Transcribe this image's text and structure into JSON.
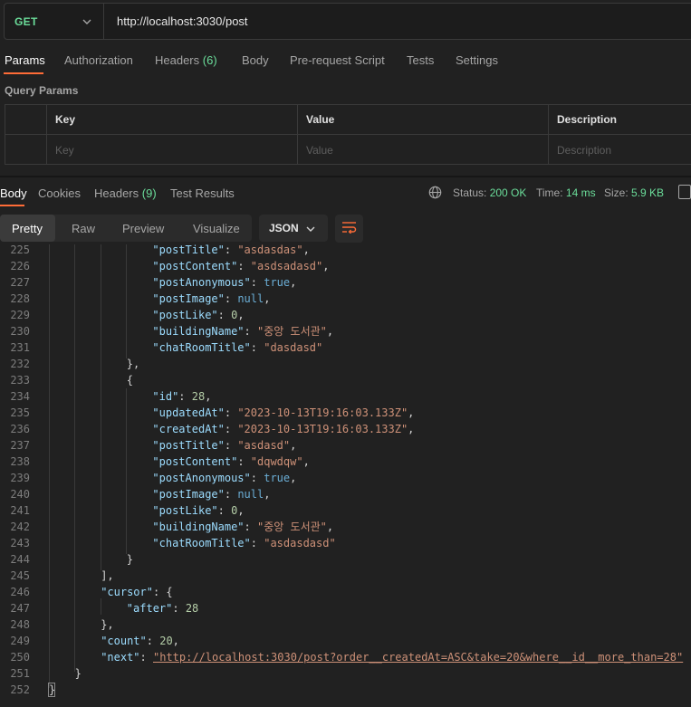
{
  "request": {
    "method": "GET",
    "url": "http://localhost:3030/post"
  },
  "req_tabs": {
    "params": "Params",
    "authorization": "Authorization",
    "headers": "Headers",
    "headers_count": "(6)",
    "body": "Body",
    "prerequest": "Pre-request Script",
    "tests": "Tests",
    "settings": "Settings"
  },
  "query_params": {
    "title": "Query Params",
    "headers": [
      "Key",
      "Value",
      "Description"
    ],
    "placeholders": [
      "Key",
      "Value",
      "Description"
    ]
  },
  "response": {
    "tabs": {
      "body": "Body",
      "cookies": "Cookies",
      "headers": "Headers",
      "headers_count": "(9)",
      "test_results": "Test Results"
    },
    "status_label": "Status:",
    "status_value": "200 OK",
    "time_label": "Time:",
    "time_value": "14 ms",
    "size_label": "Size:",
    "size_value": "5.9 KB"
  },
  "view": {
    "pretty": "Pretty",
    "raw": "Raw",
    "preview": "Preview",
    "visualize": "Visualize",
    "format": "JSON"
  },
  "code_lines": [
    {
      "n": "225",
      "indent": 4,
      "parts": [
        [
          "key",
          "\"postTitle\""
        ],
        [
          "p",
          ": "
        ],
        [
          "str",
          "\"asdasdas\""
        ],
        [
          "p",
          ","
        ]
      ]
    },
    {
      "n": "226",
      "indent": 4,
      "parts": [
        [
          "key",
          "\"postContent\""
        ],
        [
          "p",
          ": "
        ],
        [
          "str",
          "\"asdsadasd\""
        ],
        [
          "p",
          ","
        ]
      ]
    },
    {
      "n": "227",
      "indent": 4,
      "parts": [
        [
          "key",
          "\"postAnonymous\""
        ],
        [
          "p",
          ": "
        ],
        [
          "lit",
          "true"
        ],
        [
          "p",
          ","
        ]
      ]
    },
    {
      "n": "228",
      "indent": 4,
      "parts": [
        [
          "key",
          "\"postImage\""
        ],
        [
          "p",
          ": "
        ],
        [
          "lit",
          "null"
        ],
        [
          "p",
          ","
        ]
      ]
    },
    {
      "n": "229",
      "indent": 4,
      "parts": [
        [
          "key",
          "\"postLike\""
        ],
        [
          "p",
          ": "
        ],
        [
          "num",
          "0"
        ],
        [
          "p",
          ","
        ]
      ]
    },
    {
      "n": "230",
      "indent": 4,
      "parts": [
        [
          "key",
          "\"buildingName\""
        ],
        [
          "p",
          ": "
        ],
        [
          "str",
          "\"중앙 도서관\""
        ],
        [
          "p",
          ","
        ]
      ]
    },
    {
      "n": "231",
      "indent": 4,
      "parts": [
        [
          "key",
          "\"chatRoomTitle\""
        ],
        [
          "p",
          ": "
        ],
        [
          "str",
          "\"dasdasd\""
        ]
      ]
    },
    {
      "n": "232",
      "indent": 3,
      "parts": [
        [
          "p",
          "},"
        ]
      ]
    },
    {
      "n": "233",
      "indent": 3,
      "parts": [
        [
          "p",
          "{"
        ]
      ]
    },
    {
      "n": "234",
      "indent": 4,
      "parts": [
        [
          "key",
          "\"id\""
        ],
        [
          "p",
          ": "
        ],
        [
          "num",
          "28"
        ],
        [
          "p",
          ","
        ]
      ]
    },
    {
      "n": "235",
      "indent": 4,
      "parts": [
        [
          "key",
          "\"updatedAt\""
        ],
        [
          "p",
          ": "
        ],
        [
          "str",
          "\"2023-10-13T19:16:03.133Z\""
        ],
        [
          "p",
          ","
        ]
      ]
    },
    {
      "n": "236",
      "indent": 4,
      "parts": [
        [
          "key",
          "\"createdAt\""
        ],
        [
          "p",
          ": "
        ],
        [
          "str",
          "\"2023-10-13T19:16:03.133Z\""
        ],
        [
          "p",
          ","
        ]
      ]
    },
    {
      "n": "237",
      "indent": 4,
      "parts": [
        [
          "key",
          "\"postTitle\""
        ],
        [
          "p",
          ": "
        ],
        [
          "str",
          "\"asdasd\""
        ],
        [
          "p",
          ","
        ]
      ]
    },
    {
      "n": "238",
      "indent": 4,
      "parts": [
        [
          "key",
          "\"postContent\""
        ],
        [
          "p",
          ": "
        ],
        [
          "str",
          "\"dqwdqw\""
        ],
        [
          "p",
          ","
        ]
      ]
    },
    {
      "n": "239",
      "indent": 4,
      "parts": [
        [
          "key",
          "\"postAnonymous\""
        ],
        [
          "p",
          ": "
        ],
        [
          "lit",
          "true"
        ],
        [
          "p",
          ","
        ]
      ]
    },
    {
      "n": "240",
      "indent": 4,
      "parts": [
        [
          "key",
          "\"postImage\""
        ],
        [
          "p",
          ": "
        ],
        [
          "lit",
          "null"
        ],
        [
          "p",
          ","
        ]
      ]
    },
    {
      "n": "241",
      "indent": 4,
      "parts": [
        [
          "key",
          "\"postLike\""
        ],
        [
          "p",
          ": "
        ],
        [
          "num",
          "0"
        ],
        [
          "p",
          ","
        ]
      ]
    },
    {
      "n": "242",
      "indent": 4,
      "parts": [
        [
          "key",
          "\"buildingName\""
        ],
        [
          "p",
          ": "
        ],
        [
          "str",
          "\"중앙 도서관\""
        ],
        [
          "p",
          ","
        ]
      ]
    },
    {
      "n": "243",
      "indent": 4,
      "parts": [
        [
          "key",
          "\"chatRoomTitle\""
        ],
        [
          "p",
          ": "
        ],
        [
          "str",
          "\"asdasdasd\""
        ]
      ]
    },
    {
      "n": "244",
      "indent": 3,
      "parts": [
        [
          "p",
          "}"
        ]
      ]
    },
    {
      "n": "245",
      "indent": 2,
      "parts": [
        [
          "p",
          "],"
        ]
      ]
    },
    {
      "n": "246",
      "indent": 2,
      "parts": [
        [
          "key",
          "\"cursor\""
        ],
        [
          "p",
          ": {"
        ]
      ]
    },
    {
      "n": "247",
      "indent": 3,
      "parts": [
        [
          "key",
          "\"after\""
        ],
        [
          "p",
          ": "
        ],
        [
          "num",
          "28"
        ]
      ]
    },
    {
      "n": "248",
      "indent": 2,
      "parts": [
        [
          "p",
          "},"
        ]
      ]
    },
    {
      "n": "249",
      "indent": 2,
      "parts": [
        [
          "key",
          "\"count\""
        ],
        [
          "p",
          ": "
        ],
        [
          "num",
          "20"
        ],
        [
          "p",
          ","
        ]
      ]
    },
    {
      "n": "250",
      "indent": 2,
      "parts": [
        [
          "key",
          "\"next\""
        ],
        [
          "p",
          ": "
        ],
        [
          "link",
          "\"http://localhost:3030/post?order__createdAt=ASC&take=20&where__id__more_than=28\""
        ]
      ]
    },
    {
      "n": "251",
      "indent": 1,
      "parts": [
        [
          "p",
          "}"
        ]
      ]
    },
    {
      "n": "252",
      "indent": 0,
      "parts": [
        [
          "p",
          "}"
        ]
      ]
    }
  ],
  "colors": {
    "accent": "#ff6c37",
    "method": "#6bdd9a",
    "background": "#212121"
  }
}
